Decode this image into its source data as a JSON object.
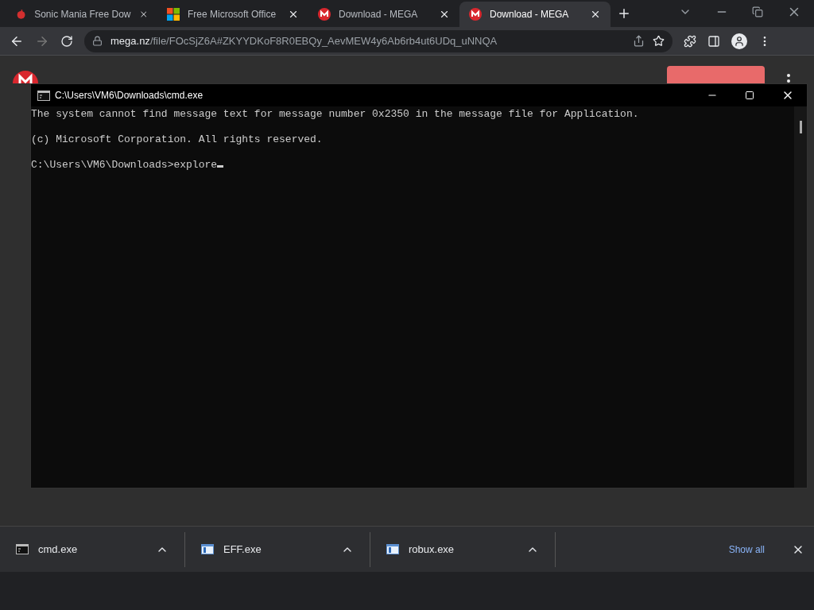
{
  "tabs": [
    {
      "title": "Sonic Mania Free Dow",
      "kind": "sonic",
      "selected": false
    },
    {
      "title": "Free Microsoft Office",
      "kind": "windows",
      "selected": false
    },
    {
      "title": "Download - MEGA",
      "kind": "mega",
      "selected": false
    },
    {
      "title": "Download - MEGA",
      "kind": "mega",
      "selected": true
    }
  ],
  "address": {
    "domain": "mega.nz",
    "path": "/file/FOcSjZ6A#ZKYYDKoF8R0EBQy_AevMEW4y6Ab6rb4ut6UDq_uNNQA"
  },
  "console": {
    "title": "C:\\Users\\VM6\\Downloads\\cmd.exe",
    "lines": [
      "The system cannot find message text for message number 0x2350 in the message file for Application.",
      "(c) Microsoft Corporation. All rights reserved.",
      "C:\\Users\\VM6\\Downloads>explore"
    ]
  },
  "downloads": [
    {
      "name": "cmd.exe",
      "kind": "console"
    },
    {
      "name": "EFF.exe",
      "kind": "app"
    },
    {
      "name": "robux.exe",
      "kind": "app"
    }
  ],
  "show_all": "Show all"
}
